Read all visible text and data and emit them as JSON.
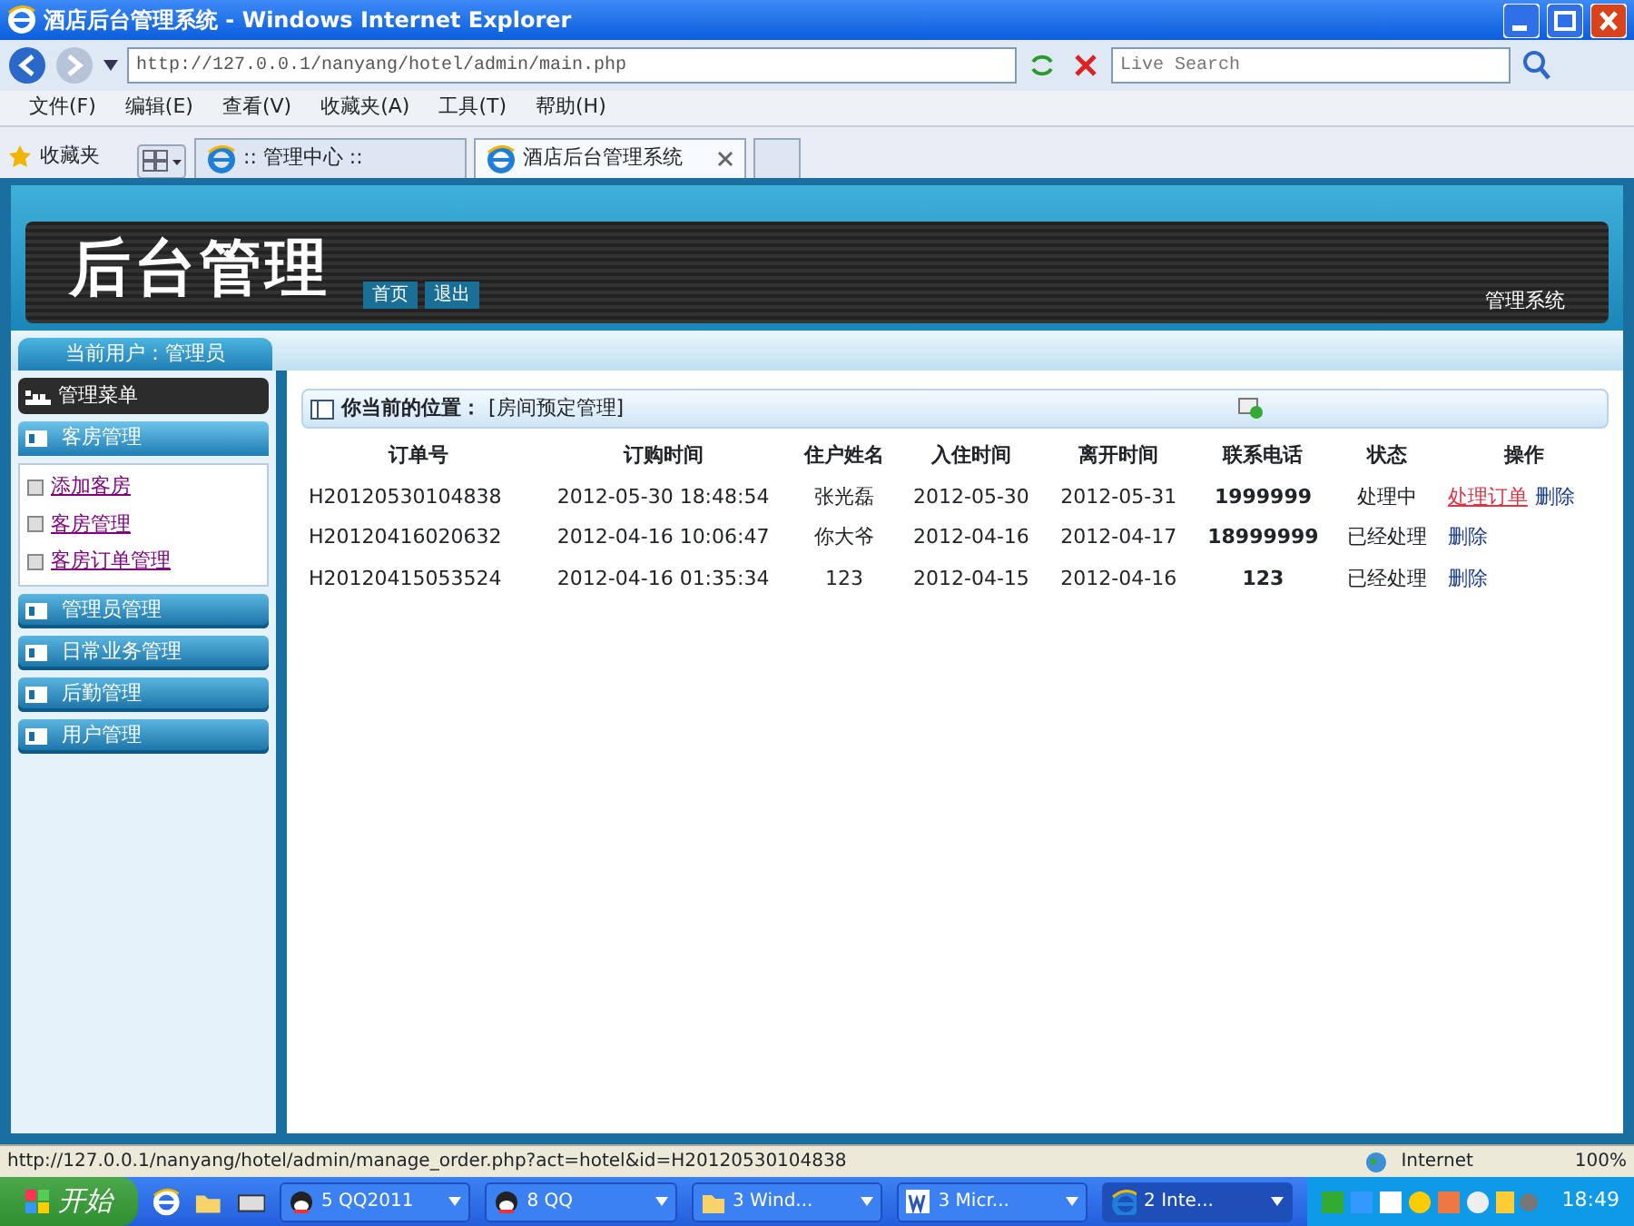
{
  "window": {
    "title": "酒店后台管理系统 - Windows Internet Explorer"
  },
  "address_bar": {
    "url": "http://127.0.0.1/nanyang/hotel/admin/main.php"
  },
  "search": {
    "placeholder": "Live Search"
  },
  "menu": [
    "文件(F)",
    "编辑(E)",
    "查看(V)",
    "收藏夹(A)",
    "工具(T)",
    "帮助(H)"
  ],
  "favorites": "收藏夹",
  "tabs": [
    {
      "label": ":: 管理中心 ::",
      "selected": false
    },
    {
      "label": "酒店后台管理系统",
      "selected": true
    }
  ],
  "banner": {
    "title": "后台管理",
    "buttons": [
      "首页",
      "退出"
    ],
    "subtitle": "管理系统"
  },
  "current_user": "当前用户：管理员",
  "sidebar": {
    "header": "管理菜单",
    "groups": [
      {
        "label": "客房管理",
        "expanded": true,
        "items": [
          "添加客房",
          "客房管理",
          "客房订单管理"
        ]
      },
      {
        "label": "管理员管理",
        "expanded": false
      },
      {
        "label": "日常业务管理",
        "expanded": false
      },
      {
        "label": "后勤管理",
        "expanded": false
      },
      {
        "label": "用户管理",
        "expanded": false
      }
    ]
  },
  "panel": {
    "location_label": "你当前的位置：",
    "location": "[房间预定管理]"
  },
  "table": {
    "columns": [
      "订单号",
      "订购时间",
      "住户姓名",
      "入住时间",
      "离开时间",
      "联系电话",
      "状态",
      "操作"
    ],
    "rows": [
      {
        "cells": [
          "H20120530104838",
          "2012-05-30 18:48:54",
          "张光磊",
          "2012-05-30",
          "2012-05-31",
          "1999999",
          "处理中"
        ],
        "actions": [
          {
            "label": "处理订单",
            "kind": "process"
          },
          {
            "label": "删除",
            "kind": "delete"
          }
        ]
      },
      {
        "cells": [
          "H20120416020632",
          "2012-04-16 10:06:47",
          "你大爷",
          "2012-04-16",
          "2012-04-17",
          "18999999",
          "已经处理"
        ],
        "actions": [
          {
            "label": "删除",
            "kind": "delete"
          }
        ]
      },
      {
        "cells": [
          "H20120415053524",
          "2012-04-16 01:35:34",
          "123",
          "2012-04-15",
          "2012-04-16",
          "123",
          "已经处理"
        ],
        "actions": [
          {
            "label": "删除",
            "kind": "delete"
          }
        ]
      }
    ]
  },
  "status_bar": {
    "url": "http://127.0.0.1/nanyang/hotel/admin/manage_order.php?act=hotel&id=H20120530104838",
    "zone": "Internet",
    "zoom": "100%"
  },
  "taskbar": {
    "start": "开始",
    "tasks": [
      {
        "label": "5 QQ2011",
        "kind": "qq",
        "selected": false
      },
      {
        "label": "8 QQ",
        "kind": "qq",
        "selected": false
      },
      {
        "label": "3 Wind...",
        "kind": "folder",
        "selected": false
      },
      {
        "label": "3 Micr...",
        "kind": "word",
        "selected": false
      },
      {
        "label": "2 Inte...",
        "kind": "ie",
        "selected": true
      }
    ],
    "clock": "18:49"
  }
}
